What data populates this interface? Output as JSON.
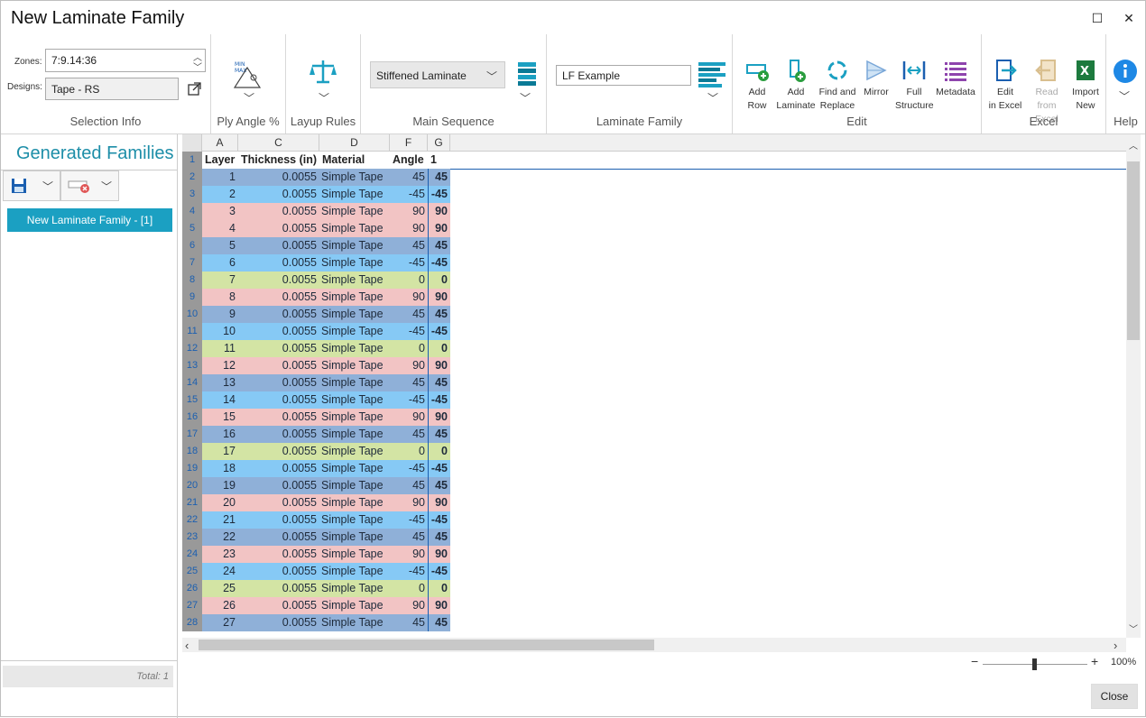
{
  "window": {
    "title": "New Laminate Family",
    "maximize_glyph": "☐",
    "close_glyph": "✕"
  },
  "ribbon": {
    "selection_info": {
      "zones_label": "Zones:",
      "zones_value": "7:9.14:36",
      "designs_label": "Designs:",
      "designs_value": "Tape - RS",
      "group_label": "Selection Info"
    },
    "ply_angle": {
      "group_label": "Ply Angle %",
      "icon_text_top": "MIN",
      "icon_text_bottom": "MAX"
    },
    "layup_rules": {
      "group_label": "Layup Rules"
    },
    "main_sequence": {
      "selected": "Stiffened Laminate",
      "group_label": "Main Sequence"
    },
    "laminate_family": {
      "value": "LF Example",
      "group_label": "Laminate Family"
    },
    "edit": {
      "group_label": "Edit",
      "buttons": [
        {
          "line1": "Add",
          "line2": "Row"
        },
        {
          "line1": "Add",
          "line2": "Laminate"
        },
        {
          "line1": "Find and",
          "line2": "Replace"
        },
        {
          "line1": "Mirror",
          "line2": ""
        },
        {
          "line1": "Full",
          "line2": "Structure"
        },
        {
          "line1": "Metadata",
          "line2": ""
        }
      ]
    },
    "excel": {
      "group_label": "Excel",
      "buttons": [
        {
          "line1": "Edit",
          "line2": "in Excel"
        },
        {
          "line1": "Read",
          "line2": "from Excel"
        },
        {
          "line1": "Import",
          "line2": "New"
        }
      ]
    },
    "help": {
      "group_label": "Help"
    }
  },
  "left_panel": {
    "title": "Generated Families",
    "family_item": "New Laminate Family - [1]",
    "total": "Total: 1"
  },
  "sheet": {
    "column_letters": [
      "A",
      "C",
      "D",
      "F",
      "G"
    ],
    "headers": [
      "Layer",
      "Thickness (in)",
      "Material",
      "Angle",
      "1"
    ],
    "row_numbers": [
      "1",
      "2",
      "3",
      "4",
      "5",
      "6",
      "7",
      "8",
      "9",
      "10",
      "11",
      "12",
      "13",
      "14",
      "15",
      "16",
      "17",
      "18",
      "19",
      "20",
      "21",
      "22",
      "23",
      "24",
      "25",
      "26",
      "27",
      "28"
    ],
    "rows": [
      {
        "layer": "1",
        "thick": "0.0055",
        "mat": "Simple Tape",
        "angle": "45",
        "g": "45"
      },
      {
        "layer": "2",
        "thick": "0.0055",
        "mat": "Simple Tape",
        "angle": "-45",
        "g": "-45"
      },
      {
        "layer": "3",
        "thick": "0.0055",
        "mat": "Simple Tape",
        "angle": "90",
        "g": "90"
      },
      {
        "layer": "4",
        "thick": "0.0055",
        "mat": "Simple Tape",
        "angle": "90",
        "g": "90"
      },
      {
        "layer": "5",
        "thick": "0.0055",
        "mat": "Simple Tape",
        "angle": "45",
        "g": "45"
      },
      {
        "layer": "6",
        "thick": "0.0055",
        "mat": "Simple Tape",
        "angle": "-45",
        "g": "-45"
      },
      {
        "layer": "7",
        "thick": "0.0055",
        "mat": "Simple Tape",
        "angle": "0",
        "g": "0"
      },
      {
        "layer": "8",
        "thick": "0.0055",
        "mat": "Simple Tape",
        "angle": "90",
        "g": "90"
      },
      {
        "layer": "9",
        "thick": "0.0055",
        "mat": "Simple Tape",
        "angle": "45",
        "g": "45"
      },
      {
        "layer": "10",
        "thick": "0.0055",
        "mat": "Simple Tape",
        "angle": "-45",
        "g": "-45"
      },
      {
        "layer": "11",
        "thick": "0.0055",
        "mat": "Simple Tape",
        "angle": "0",
        "g": "0"
      },
      {
        "layer": "12",
        "thick": "0.0055",
        "mat": "Simple Tape",
        "angle": "90",
        "g": "90"
      },
      {
        "layer": "13",
        "thick": "0.0055",
        "mat": "Simple Tape",
        "angle": "45",
        "g": "45"
      },
      {
        "layer": "14",
        "thick": "0.0055",
        "mat": "Simple Tape",
        "angle": "-45",
        "g": "-45"
      },
      {
        "layer": "15",
        "thick": "0.0055",
        "mat": "Simple Tape",
        "angle": "90",
        "g": "90"
      },
      {
        "layer": "16",
        "thick": "0.0055",
        "mat": "Simple Tape",
        "angle": "45",
        "g": "45"
      },
      {
        "layer": "17",
        "thick": "0.0055",
        "mat": "Simple Tape",
        "angle": "0",
        "g": "0"
      },
      {
        "layer": "18",
        "thick": "0.0055",
        "mat": "Simple Tape",
        "angle": "-45",
        "g": "-45"
      },
      {
        "layer": "19",
        "thick": "0.0055",
        "mat": "Simple Tape",
        "angle": "45",
        "g": "45"
      },
      {
        "layer": "20",
        "thick": "0.0055",
        "mat": "Simple Tape",
        "angle": "90",
        "g": "90"
      },
      {
        "layer": "21",
        "thick": "0.0055",
        "mat": "Simple Tape",
        "angle": "-45",
        "g": "-45"
      },
      {
        "layer": "22",
        "thick": "0.0055",
        "mat": "Simple Tape",
        "angle": "45",
        "g": "45"
      },
      {
        "layer": "23",
        "thick": "0.0055",
        "mat": "Simple Tape",
        "angle": "90",
        "g": "90"
      },
      {
        "layer": "24",
        "thick": "0.0055",
        "mat": "Simple Tape",
        "angle": "-45",
        "g": "-45"
      },
      {
        "layer": "25",
        "thick": "0.0055",
        "mat": "Simple Tape",
        "angle": "0",
        "g": "0"
      },
      {
        "layer": "26",
        "thick": "0.0055",
        "mat": "Simple Tape",
        "angle": "90",
        "g": "90"
      },
      {
        "layer": "27",
        "thick": "0.0055",
        "mat": "Simple Tape",
        "angle": "45",
        "g": "45"
      }
    ],
    "angle_colors": {
      "45": "#8fb0d8",
      "-45": "#86c9f5",
      "90": "#f2c4c4",
      "0": "#d3e4a4"
    }
  },
  "zoom": {
    "minus": "−",
    "plus": "+",
    "value": "100%",
    "level_percent": 100
  },
  "footer": {
    "close_label": "Close"
  },
  "colors": {
    "accent": "#1ba0c2",
    "title_teal": "#1d8ea8",
    "row_header_bg": "#999999",
    "row_number": "#1b5fb0"
  }
}
